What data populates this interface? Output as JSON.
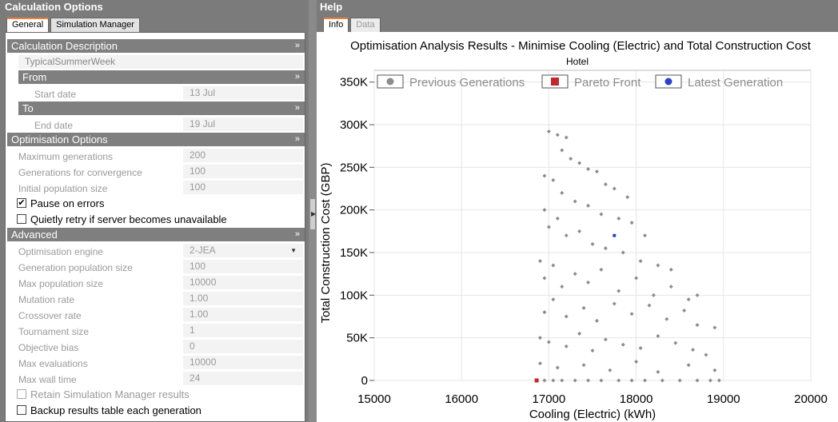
{
  "left_panel": {
    "title": "Calculation Options",
    "tabs": [
      "General",
      "Simulation Manager"
    ],
    "calc_description": {
      "header": "Calculation Description",
      "name": "TypicalSummerWeek",
      "from": {
        "header": "From",
        "start_label": "Start date",
        "start_value": "13 Jul"
      },
      "to": {
        "header": "To",
        "end_label": "End date",
        "end_value": "19 Jul"
      }
    },
    "optimisation": {
      "header": "Optimisation Options",
      "rows": [
        {
          "label": "Maximum generations",
          "value": "200"
        },
        {
          "label": "Generations for convergence",
          "value": "100"
        },
        {
          "label": "Initial population size",
          "value": "100"
        }
      ],
      "pause_label": "Pause on errors",
      "pause_checked": true,
      "retry_label": "Quietly retry if server becomes unavailable",
      "retry_checked": false
    },
    "advanced": {
      "header": "Advanced",
      "engine_label": "Optimisation engine",
      "engine_value": "2-JEA",
      "rows": [
        {
          "label": "Generation population size",
          "value": "100"
        },
        {
          "label": "Max population size",
          "value": "10000"
        },
        {
          "label": "Mutation rate",
          "value": "1.00"
        },
        {
          "label": "Crossover rate",
          "value": "1.00"
        },
        {
          "label": "Tournament size",
          "value": "1"
        },
        {
          "label": "Objective bias",
          "value": "0"
        },
        {
          "label": "Max evaluations",
          "value": "10000"
        },
        {
          "label": "Max wall time",
          "value": "24"
        }
      ],
      "retain_label": "Retain Simulation Manager results",
      "retain_checked": false,
      "backup_label": "Backup results table each generation",
      "backup_checked": false
    }
  },
  "right_panel": {
    "title": "Help",
    "tabs": [
      "Info",
      "Data"
    ]
  },
  "chart_data": {
    "type": "scatter",
    "title": "Optimisation Analysis Results - Minimise Cooling (Electric) and Total Construction Cost",
    "subtitle": "Hotel",
    "xlabel": "Cooling (Electric) (kWh)",
    "ylabel": "Total Construction Cost (GBP)",
    "xlim": [
      15000,
      20000
    ],
    "ylim": [
      0,
      360000
    ],
    "xticks": [
      "15000",
      "16000",
      "17000",
      "18000",
      "19000",
      "20000"
    ],
    "yticks": [
      "0",
      "50K",
      "100K",
      "150K",
      "200K",
      "250K",
      "300K",
      "350K"
    ],
    "grid": true,
    "legend_position": "top",
    "series": [
      {
        "name": "Previous Generations",
        "color": "#8c8c8c",
        "marker": "diamond",
        "points": [
          [
            16950,
            0
          ],
          [
            17050,
            0
          ],
          [
            17150,
            0
          ],
          [
            17300,
            0
          ],
          [
            17450,
            0
          ],
          [
            17600,
            0
          ],
          [
            17800,
            0
          ],
          [
            17950,
            0
          ],
          [
            18100,
            0
          ],
          [
            18300,
            0
          ],
          [
            18500,
            0
          ],
          [
            18700,
            0
          ],
          [
            18850,
            0
          ],
          [
            18950,
            0
          ],
          [
            16900,
            20000
          ],
          [
            17100,
            15000
          ],
          [
            17400,
            18000
          ],
          [
            17700,
            12000
          ],
          [
            18000,
            22000
          ],
          [
            18250,
            10000
          ],
          [
            18600,
            18000
          ],
          [
            18900,
            12000
          ],
          [
            16900,
            50000
          ],
          [
            17000,
            45000
          ],
          [
            17200,
            40000
          ],
          [
            17350,
            55000
          ],
          [
            17500,
            35000
          ],
          [
            17650,
            48000
          ],
          [
            17850,
            42000
          ],
          [
            18050,
            38000
          ],
          [
            18250,
            52000
          ],
          [
            18450,
            44000
          ],
          [
            18650,
            36000
          ],
          [
            18800,
            30000
          ],
          [
            16950,
            80000
          ],
          [
            17050,
            95000
          ],
          [
            17200,
            75000
          ],
          [
            17400,
            85000
          ],
          [
            17550,
            70000
          ],
          [
            17750,
            90000
          ],
          [
            17950,
            78000
          ],
          [
            18150,
            88000
          ],
          [
            18350,
            72000
          ],
          [
            18550,
            82000
          ],
          [
            18700,
            65000
          ],
          [
            18900,
            62000
          ],
          [
            16900,
            140000
          ],
          [
            16950,
            120000
          ],
          [
            17050,
            135000
          ],
          [
            17150,
            110000
          ],
          [
            17300,
            125000
          ],
          [
            17450,
            115000
          ],
          [
            17600,
            130000
          ],
          [
            17800,
            105000
          ],
          [
            18000,
            120000
          ],
          [
            18200,
            100000
          ],
          [
            18400,
            110000
          ],
          [
            18600,
            95000
          ],
          [
            18700,
            100000
          ],
          [
            16950,
            200000
          ],
          [
            17000,
            180000
          ],
          [
            17100,
            190000
          ],
          [
            17200,
            170000
          ],
          [
            17350,
            175000
          ],
          [
            17500,
            160000
          ],
          [
            17650,
            155000
          ],
          [
            17850,
            150000
          ],
          [
            18050,
            140000
          ],
          [
            18250,
            135000
          ],
          [
            18400,
            130000
          ],
          [
            16950,
            240000
          ],
          [
            17050,
            235000
          ],
          [
            17150,
            220000
          ],
          [
            17300,
            210000
          ],
          [
            17450,
            205000
          ],
          [
            17600,
            195000
          ],
          [
            17800,
            190000
          ],
          [
            17950,
            185000
          ],
          [
            18100,
            170000
          ],
          [
            17000,
            292000
          ],
          [
            17100,
            288000
          ],
          [
            17200,
            285000
          ],
          [
            17150,
            270000
          ],
          [
            17250,
            260000
          ],
          [
            17350,
            255000
          ],
          [
            17450,
            248000
          ],
          [
            17550,
            245000
          ],
          [
            17650,
            230000
          ],
          [
            17750,
            225000
          ],
          [
            17900,
            215000
          ]
        ]
      },
      {
        "name": "Pareto Front",
        "color": "#c0282c",
        "marker": "square",
        "points": [
          [
            16860,
            0
          ]
        ]
      },
      {
        "name": "Latest Generation",
        "color": "#2b3fd0",
        "marker": "circle",
        "points": [
          [
            17750,
            170000
          ]
        ]
      }
    ]
  }
}
